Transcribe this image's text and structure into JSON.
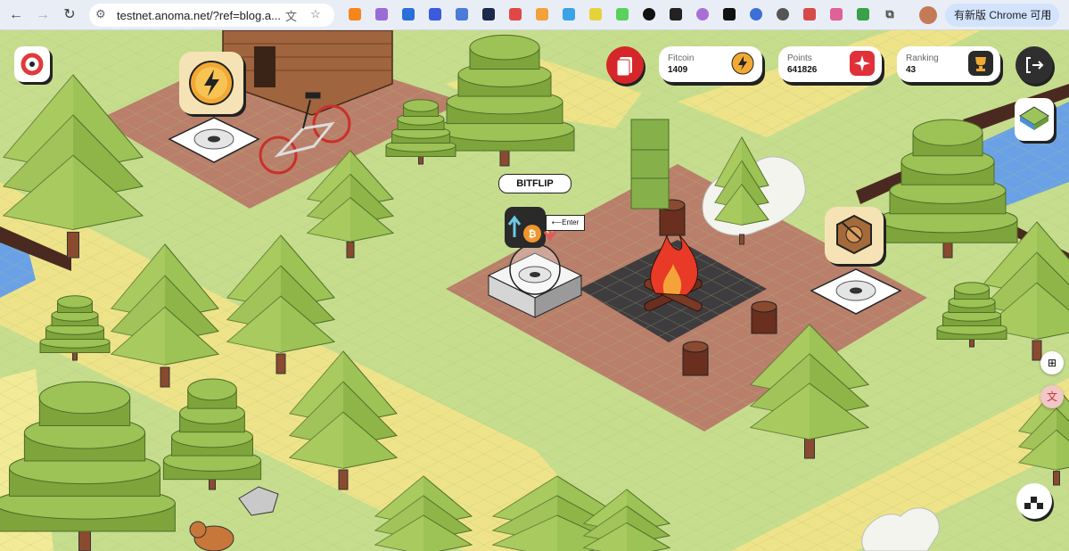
{
  "browser": {
    "url": "testnet.anoma.net/?ref=blog.a...",
    "update_label": "有新版 Chrome 可用"
  },
  "hud": {
    "fitcoin": {
      "label": "Fitcoin",
      "value": "1409"
    },
    "points": {
      "label": "Points",
      "value": "641826"
    },
    "ranking": {
      "label": "Ranking",
      "value": "43"
    }
  },
  "game": {
    "station_label": "BITFLIP",
    "enter_hint": "⟵Enter"
  },
  "colors": {
    "grass": "#c6dd8e",
    "path": "#efe389",
    "dirt": "#b97f6a",
    "tree": "#8fb548",
    "water": "#6aa1e6"
  }
}
